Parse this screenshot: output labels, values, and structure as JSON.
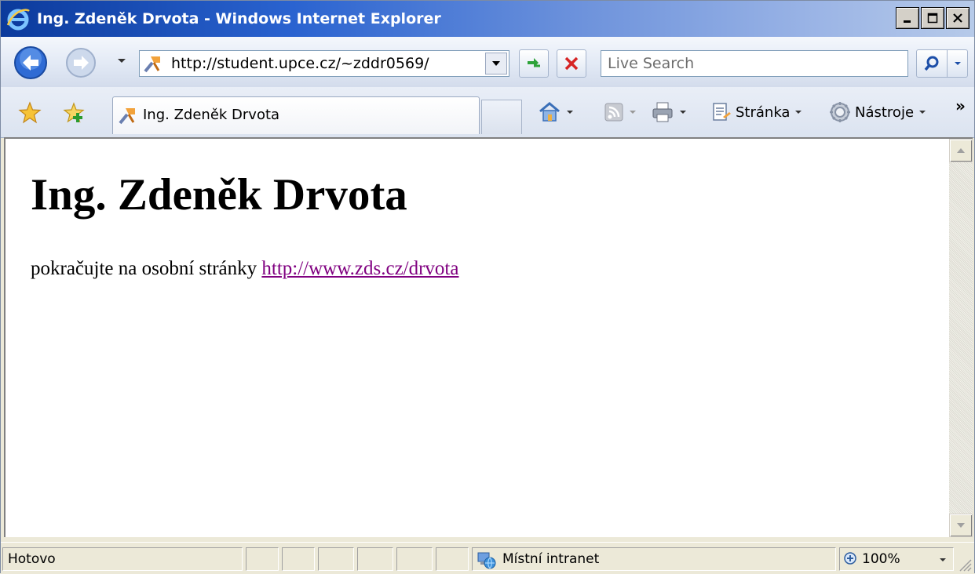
{
  "window": {
    "title": "Ing. Zdeněk Drvota - Windows Internet Explorer",
    "icon": "ie-logo-icon",
    "controls": [
      "minimize-icon",
      "maximize-icon",
      "close-icon"
    ]
  },
  "address_bar": {
    "url": "http://student.upce.cz/~zddr0569/",
    "search_placeholder": "Live Search"
  },
  "tabs": [
    {
      "label": "Ing. Zdeněk Drvota",
      "active": true
    }
  ],
  "command_bar": {
    "page_label": "Stránka",
    "tools_label": "Nástroje",
    "more_label": "»"
  },
  "page": {
    "heading": "Ing. Zdeněk Drvota",
    "text": "pokračujte na osobní stránky ",
    "link": "http://www.zds.cz/drvota",
    "link_color": "#800080"
  },
  "status_bar": {
    "status": "Hotovo",
    "zone": "Místní intranet",
    "zoom": "100%"
  },
  "colors": {
    "title_bar_start": "#0b3a9c",
    "title_bar_end": "#b6cae9",
    "chrome": "#ece9d8"
  }
}
